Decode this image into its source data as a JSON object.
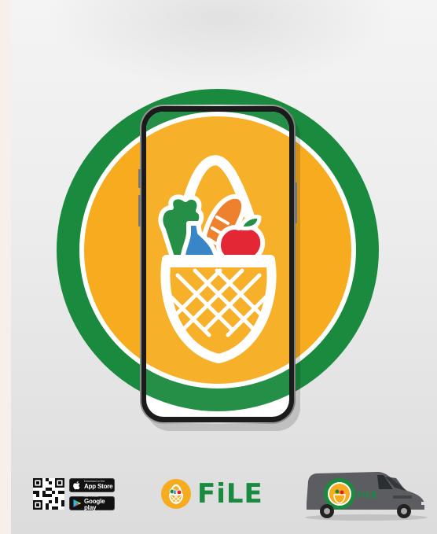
{
  "brand": {
    "name": "FiLE",
    "colors": {
      "green": "#1a8a3f",
      "orange": "#f6ac1e",
      "red": "#e21c2a",
      "blue": "#2e80c6"
    }
  },
  "hero": {
    "illustration": "shopping-basket-icon",
    "device": "smartphone"
  },
  "stores": {
    "appstore": {
      "small": "Download on the",
      "big": "App Store"
    },
    "googleplay": {
      "small": "GET IT ON",
      "big": "Google play"
    }
  },
  "van": {
    "logo_text": "FiLE"
  }
}
